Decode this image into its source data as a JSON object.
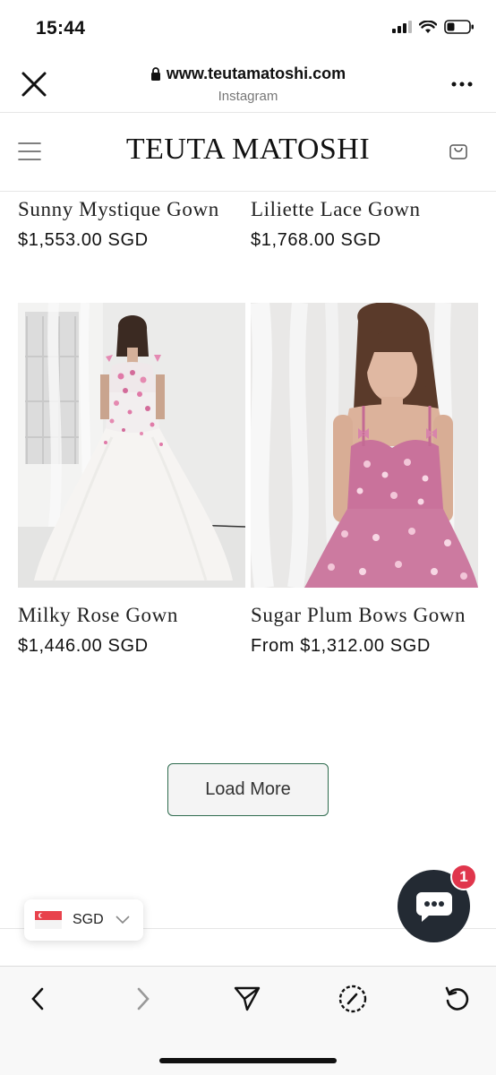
{
  "status_bar": {
    "time": "15:44"
  },
  "browser": {
    "url": "www.teutamatoshi.com",
    "source": "Instagram"
  },
  "site": {
    "logo": "TEUTA MATOSHI"
  },
  "products": [
    {
      "title": "Sunny Mystique Gown",
      "price": "$1,553.00 SGD"
    },
    {
      "title": "Liliette Lace Gown",
      "price": "$1,768.00 SGD"
    },
    {
      "title": "Milky Rose Gown",
      "price": "$1,446.00 SGD",
      "image": "white ball gown with pink floral bodice"
    },
    {
      "title": "Sugar Plum Bows Gown",
      "price": "From $1,312.00 SGD",
      "image": "pink floral gown with bow straps"
    }
  ],
  "load_more_label": "Load More",
  "currency": {
    "code": "SGD",
    "flag": "singapore-flag-icon"
  },
  "chat": {
    "badge_count": "1"
  },
  "colors": {
    "accent": "#2e6b4e",
    "chat_bg": "#232a33",
    "badge": "#e0364c"
  }
}
